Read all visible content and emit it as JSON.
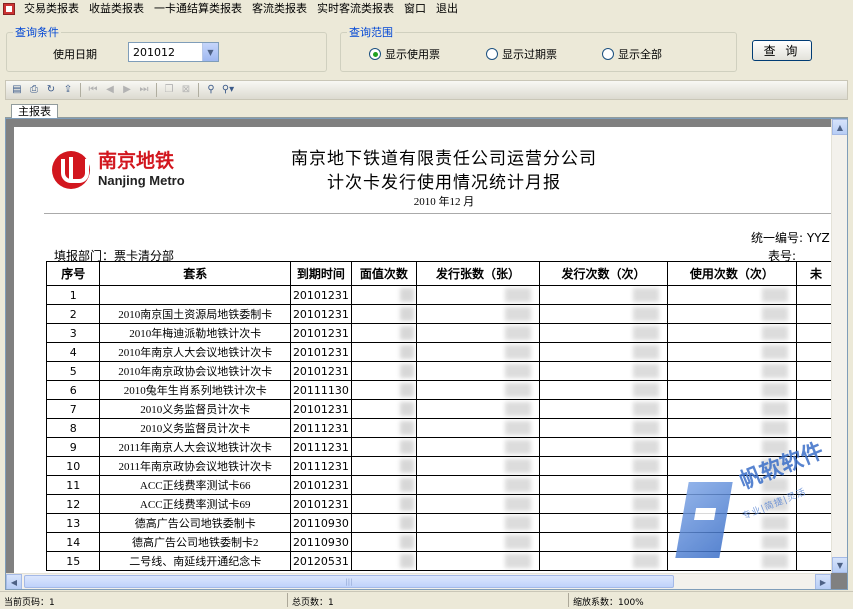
{
  "menu": [
    "交易类报表",
    "收益类报表",
    "一卡通结算类报表",
    "客流类报表",
    "实时客流类报表",
    "窗口",
    "退出"
  ],
  "query_conditions": {
    "legend": "查询条件",
    "date_label": "使用日期",
    "date_value": "201012"
  },
  "query_range": {
    "legend": "查询范围",
    "options": [
      {
        "label": "显示使用票",
        "selected": true
      },
      {
        "label": "显示过期票",
        "selected": false
      },
      {
        "label": "显示全部",
        "selected": false
      }
    ]
  },
  "query_button": "查 询",
  "tabs": [
    "主报表"
  ],
  "toolbar_icons": [
    "page-setup-icon",
    "print-icon",
    "refresh-icon",
    "export-icon",
    "first-page-icon",
    "prev-page-icon",
    "next-page-icon",
    "last-page-icon",
    "copy-icon",
    "close-icon",
    "find-icon",
    "find-next-icon"
  ],
  "report": {
    "logo_cn": "南京地铁",
    "logo_en": "Nanjing Metro",
    "title_line1": "南京地下铁道有限责任公司运营分公司",
    "title_line2": "计次卡发行使用情况统计月报",
    "period": "2010 年12 月",
    "code_label": "统一编号:",
    "code_value": "YYZ",
    "form_no_label": "表号:",
    "dept_label": "填报部门：票卡清分部",
    "columns": [
      "序号",
      "套系",
      "到期时间",
      "面值次数",
      "发行张数（张）",
      "发行次数（次）",
      "使用次数（次）",
      "未"
    ],
    "rows": [
      {
        "no": "1",
        "series": "",
        "expiry": "20101231"
      },
      {
        "no": "2",
        "series": "2010南京国土资源局地铁委制卡",
        "expiry": "20101231"
      },
      {
        "no": "3",
        "series": "2010年梅迪派勒地铁计次卡",
        "expiry": "20101231"
      },
      {
        "no": "4",
        "series": "2010年南京人大会议地铁计次卡",
        "expiry": "20101231"
      },
      {
        "no": "5",
        "series": "2010年南京政协会议地铁计次卡",
        "expiry": "20101231"
      },
      {
        "no": "6",
        "series": "2010兔年生肖系列地铁计次卡",
        "expiry": "20111130"
      },
      {
        "no": "7",
        "series": "2010义务监督员计次卡",
        "expiry": "20101231"
      },
      {
        "no": "8",
        "series": "2010义务监督员计次卡",
        "expiry": "20111231"
      },
      {
        "no": "9",
        "series": "2011年南京人大会议地铁计次卡",
        "expiry": "20111231"
      },
      {
        "no": "10",
        "series": "2011年南京政协会议地铁计次卡",
        "expiry": "20111231"
      },
      {
        "no": "11",
        "series": "ACC正线费率测试卡66",
        "expiry": "20101231"
      },
      {
        "no": "12",
        "series": "ACC正线费率测试卡69",
        "expiry": "20101231"
      },
      {
        "no": "13",
        "series": "德高广告公司地铁委制卡",
        "expiry": "20110930"
      },
      {
        "no": "14",
        "series": "德高广告公司地铁委制卡2",
        "expiry": "20110930"
      },
      {
        "no": "15",
        "series": "二号线、南延线开通纪念卡",
        "expiry": "20120531"
      }
    ]
  },
  "watermark": {
    "text": "帆软软件",
    "sub": "专业|简捷|灵活"
  },
  "status": {
    "current_page": "当前页码：1",
    "total_pages": "总页数：1",
    "zoom": "缩放系数：100%"
  }
}
